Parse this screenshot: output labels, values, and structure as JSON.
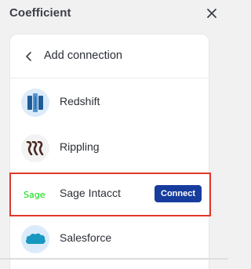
{
  "app": {
    "title": "Coefficient"
  },
  "panel": {
    "title": "Add connection"
  },
  "connections": [
    {
      "name": "Redshift",
      "logo_color": "#dcebfa",
      "icon": "redshift-logo-icon"
    },
    {
      "name": "Rippling",
      "logo_color": "#f3f3f4",
      "icon": "rippling-logo-icon"
    },
    {
      "name": "Sage Intacct",
      "logo_color": "#ffffff",
      "icon": "sage-logo-icon",
      "action_label": "Connect",
      "highlighted": true
    },
    {
      "name": "Salesforce",
      "logo_color": "#dcebfa",
      "icon": "salesforce-logo-icon"
    }
  ],
  "colors": {
    "accent": "#173c9e",
    "highlight_border": "#e0392c",
    "sage_green": "#00dc00",
    "salesforce_blue": "#1798c1"
  }
}
